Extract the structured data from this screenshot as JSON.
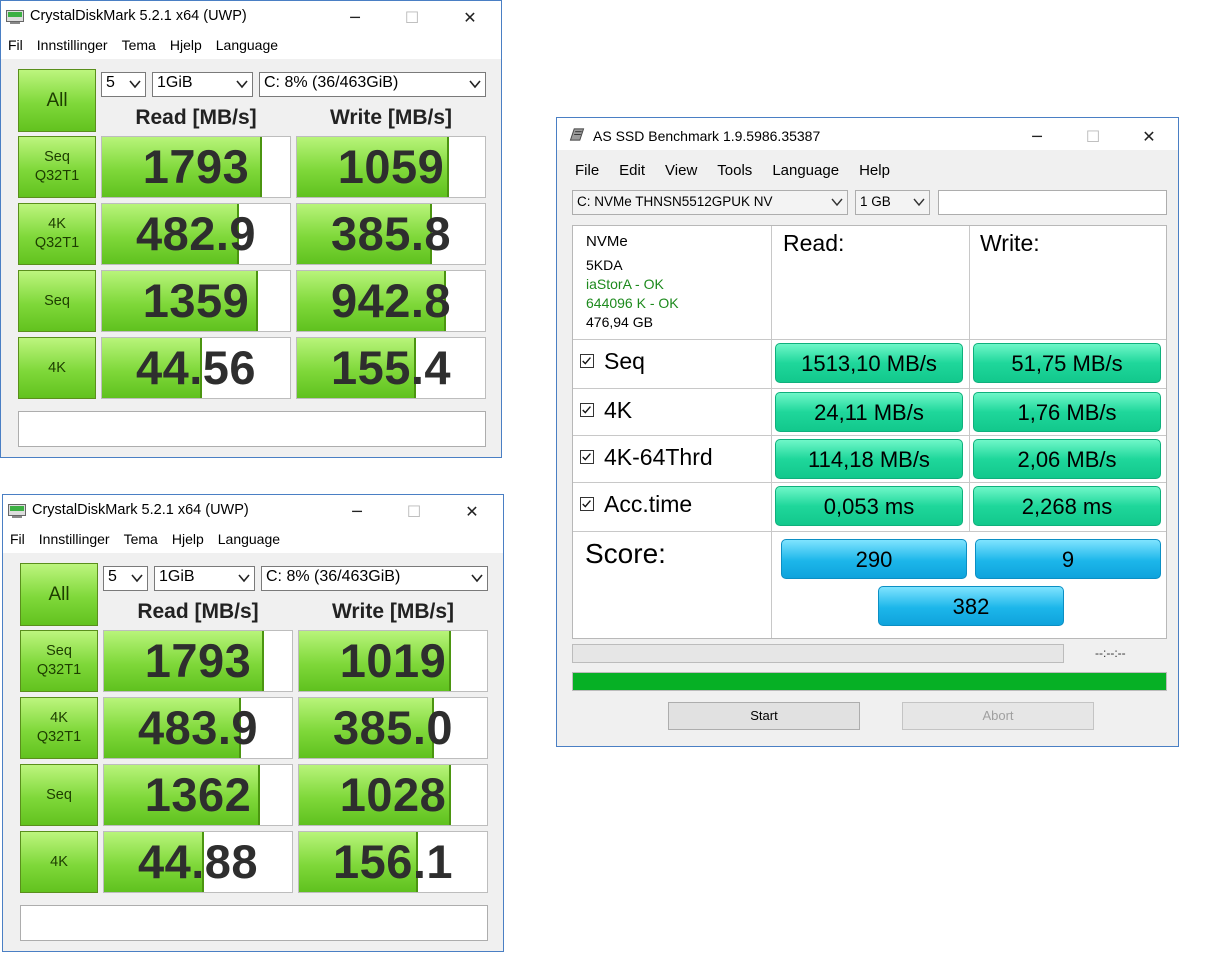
{
  "cdm_windows": [
    {
      "title": "CrystalDiskMark 5.2.1 x64 (UWP)",
      "menu": [
        "Fil",
        "Innstillinger",
        "Tema",
        "Hjelp",
        "Language"
      ],
      "all_label": "All",
      "count": "5",
      "size": "1GiB",
      "drive": "C: 8% (36/463GiB)",
      "read_header": "Read [MB/s]",
      "write_header": "Write [MB/s]",
      "rows": [
        {
          "label1": "Seq",
          "label2": "Q32T1",
          "read": "1793",
          "read_fill": 0.84,
          "write": "1059",
          "write_fill": 0.8
        },
        {
          "label1": "4K",
          "label2": "Q32T1",
          "read": "482.9",
          "read_fill": 0.72,
          "write": "385.8",
          "write_fill": 0.71
        },
        {
          "label1": "Seq",
          "label2": "",
          "read": "1359",
          "read_fill": 0.82,
          "write": "942.8",
          "write_fill": 0.78
        },
        {
          "label1": "4K",
          "label2": "",
          "read": "44.56",
          "read_fill": 0.52,
          "write": "155.4",
          "write_fill": 0.62
        }
      ]
    },
    {
      "title": "CrystalDiskMark 5.2.1 x64 (UWP)",
      "menu": [
        "Fil",
        "Innstillinger",
        "Tema",
        "Hjelp",
        "Language"
      ],
      "all_label": "All",
      "count": "5",
      "size": "1GiB",
      "drive": "C: 8% (36/463GiB)",
      "read_header": "Read [MB/s]",
      "write_header": "Write [MB/s]",
      "rows": [
        {
          "label1": "Seq",
          "label2": "Q32T1",
          "read": "1793",
          "read_fill": 0.84,
          "write": "1019",
          "write_fill": 0.8
        },
        {
          "label1": "4K",
          "label2": "Q32T1",
          "read": "483.9",
          "read_fill": 0.72,
          "write": "385.0",
          "write_fill": 0.71
        },
        {
          "label1": "Seq",
          "label2": "",
          "read": "1362",
          "read_fill": 0.82,
          "write": "1028",
          "write_fill": 0.8
        },
        {
          "label1": "4K",
          "label2": "",
          "read": "44.88",
          "read_fill": 0.52,
          "write": "156.1",
          "write_fill": 0.62
        }
      ]
    }
  ],
  "asssd": {
    "title": "AS SSD Benchmark 1.9.5986.35387",
    "menu": [
      "File",
      "Edit",
      "View",
      "Tools",
      "Language",
      "Help"
    ],
    "drive": "C: NVMe THNSN5512GPUK NV",
    "size": "1 GB",
    "info": {
      "model": "NVMe",
      "firmware": "5KDA",
      "driver": "iaStorA - OK",
      "alignment": "644096 K - OK",
      "capacity": "476,94 GB"
    },
    "read_header": "Read:",
    "write_header": "Write:",
    "tests": [
      {
        "name": "Seq",
        "read": "1513,10 MB/s",
        "write": "51,75 MB/s"
      },
      {
        "name": "4K",
        "read": "24,11 MB/s",
        "write": "1,76 MB/s"
      },
      {
        "name": "4K-64Thrd",
        "read": "114,18 MB/s",
        "write": "2,06 MB/s"
      },
      {
        "name": "Acc.time",
        "read": "0,053 ms",
        "write": "2,268 ms"
      }
    ],
    "score_label": "Score:",
    "score_read": "290",
    "score_write": "9",
    "score_total": "382",
    "time_display": "--:--:--",
    "start_label": "Start",
    "abort_label": "Abort",
    "colors": {
      "result_pill": "#1fd79b",
      "score_pill": "#1cb6ea",
      "progress": "#06b025"
    }
  }
}
